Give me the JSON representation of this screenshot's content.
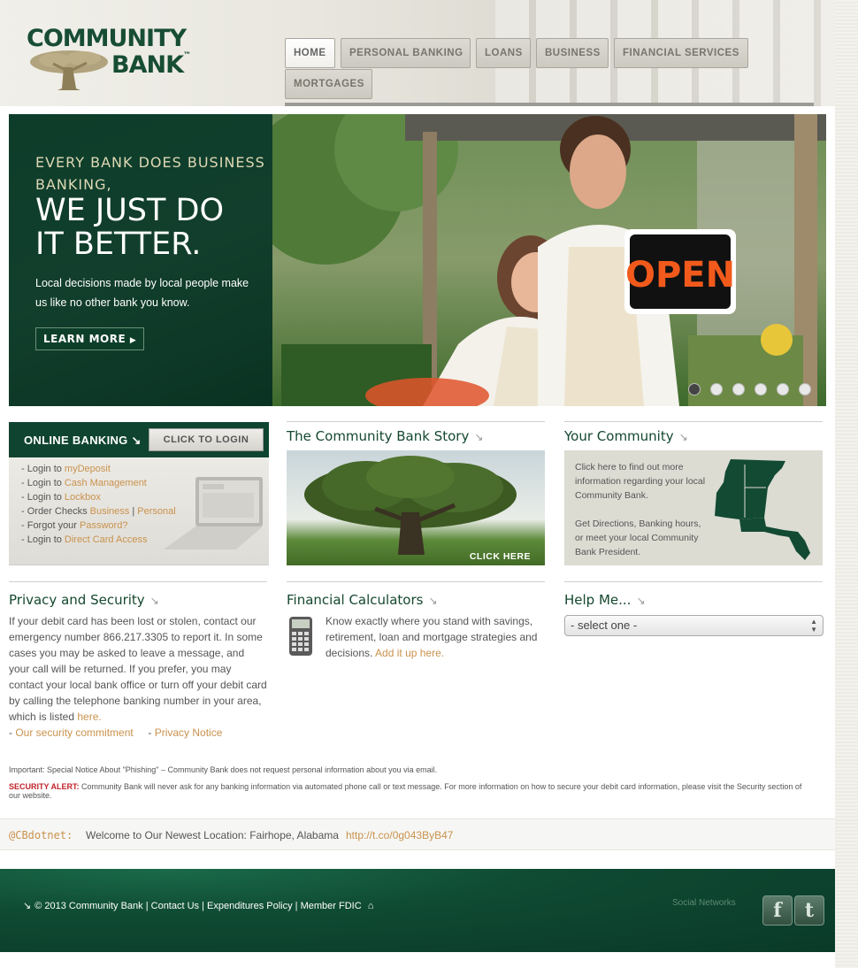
{
  "brand": {
    "line1": "COMMUNITY",
    "line2": "BANK",
    "tm": "™"
  },
  "nav": [
    {
      "label": "HOME",
      "active": true
    },
    {
      "label": "PERSONAL BANKING"
    },
    {
      "label": "LOANS"
    },
    {
      "label": "BUSINESS"
    },
    {
      "label": "FINANCIAL SERVICES"
    },
    {
      "label": "MORTGAGES"
    }
  ],
  "hero": {
    "kicker": "EVERY BANK DOES BUSINESS BANKING,",
    "headline_line1": "WE JUST DO",
    "headline_line2": "IT BETTER.",
    "subtext": "Local decisions made by local people make us like no other bank you know.",
    "button": "LEARN MORE",
    "sign_text": "OPEN",
    "slides": 6,
    "active_slide": 1
  },
  "online_banking": {
    "title": "ONLINE BANKING",
    "login_button": "CLICK TO LOGIN",
    "items": [
      {
        "prefix": "- Login to ",
        "link": "myDeposit"
      },
      {
        "prefix": "- Login to ",
        "link": "Cash Management"
      },
      {
        "prefix": "- Login to ",
        "link": "Lockbox"
      },
      {
        "prefix": "- Order Checks ",
        "link": "Business",
        "sep": " | ",
        "link2": "Personal"
      },
      {
        "prefix": "- Forgot your ",
        "link": "Password?"
      },
      {
        "prefix": "- Login to ",
        "link": "Direct Card Access"
      }
    ]
  },
  "story": {
    "title": "The Community Bank Story",
    "image_caption": "CLICK HERE"
  },
  "community": {
    "title": "Your Community",
    "para1": "Click here to find out more information regarding your local Community Bank.",
    "para2": "Get Directions, Banking hours, or meet your local Community Bank President."
  },
  "privacy": {
    "title": "Privacy and Security",
    "text": "If your debit card has been lost or stolen, contact our emergency number 866.217.3305 to report it. In some cases you may be asked to leave a message, and your call will be returned. If you prefer, you may contact your local bank office or turn off your debit card by calling the telephone banking number in your area, which is listed ",
    "here_link": "here.",
    "link1": "Our security commitment",
    "link2": "Privacy Notice"
  },
  "calculators": {
    "title": "Financial Calculators",
    "text": "Know exactly where you stand with savings, retirement, loan and mortgage strategies and decisions. ",
    "link": "Add it up here."
  },
  "help": {
    "title": "Help Me...",
    "select_value": "- select one -"
  },
  "notice": "Important: Special Notice About \"Phishing\" – Community Bank does not request personal information about you via email.",
  "alert": {
    "label": "SECURITY ALERT:",
    "text": " Community Bank will never ask for any banking information via automated phone call or text message. For more information on how to secure your debit card information, please visit the Security section of our website."
  },
  "twitter": {
    "handle": "@CBdotnet:",
    "text": "Welcome to Our Newest Location: Fairhope, Alabama",
    "link": "http://t.co/0g043ByB47"
  },
  "footer": {
    "text": "© 2013 Community Bank | Contact Us | Expenditures Policy | Member FDIC",
    "social_label": "Social Networks",
    "facebook": "f",
    "twitter_icon": "t"
  },
  "colors": {
    "brand_green": "#14482f",
    "link_orange": "#c9924d",
    "alert_red": "#c1232b"
  }
}
